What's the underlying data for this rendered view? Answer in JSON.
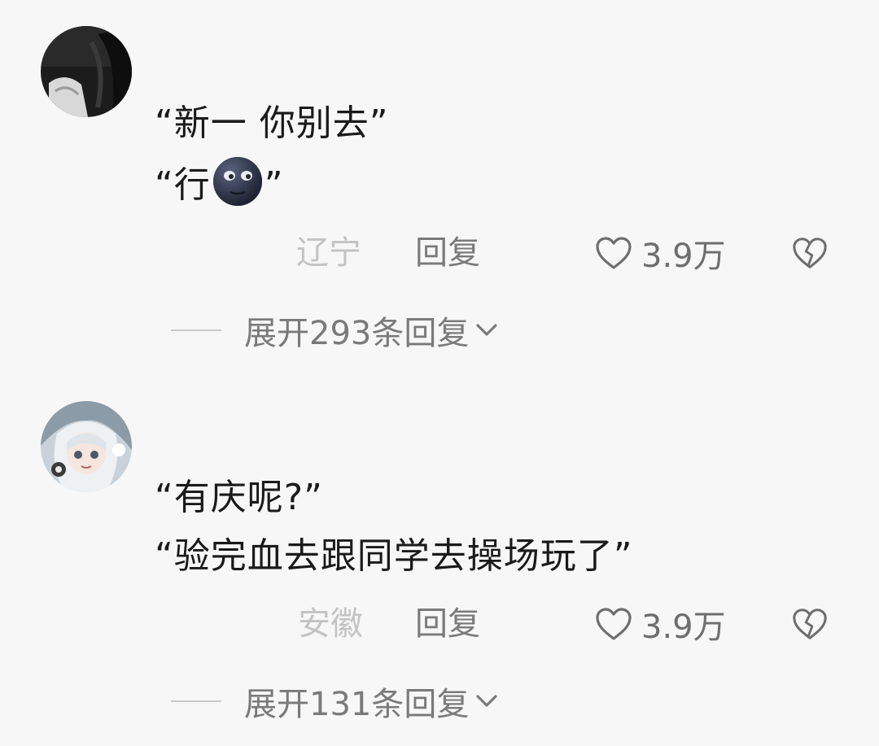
{
  "comments": [
    {
      "lines": [
        "“新一 你别去”",
        "“行",
        "”"
      ],
      "location": "辽宁",
      "reply_label": "回复",
      "likes": "3.9万",
      "expand_label": "展开293条回复",
      "emoji": "new-moon-face-emoji"
    },
    {
      "lines": [
        "“有庆呢?”",
        "“验完血去跟同学去操场玩了”"
      ],
      "location": "安徽",
      "reply_label": "回复",
      "likes": "3.9万",
      "expand_label": "展开131条回复"
    }
  ],
  "icons": {
    "like": "heart-outline-icon",
    "dislike": "broken-heart-icon",
    "expand": "chevron-down-icon"
  },
  "colors": {
    "background": "#f7f7f7",
    "text": "#1a1a1a",
    "meta": "#7a7a7a",
    "location": "#c3c3c3"
  }
}
